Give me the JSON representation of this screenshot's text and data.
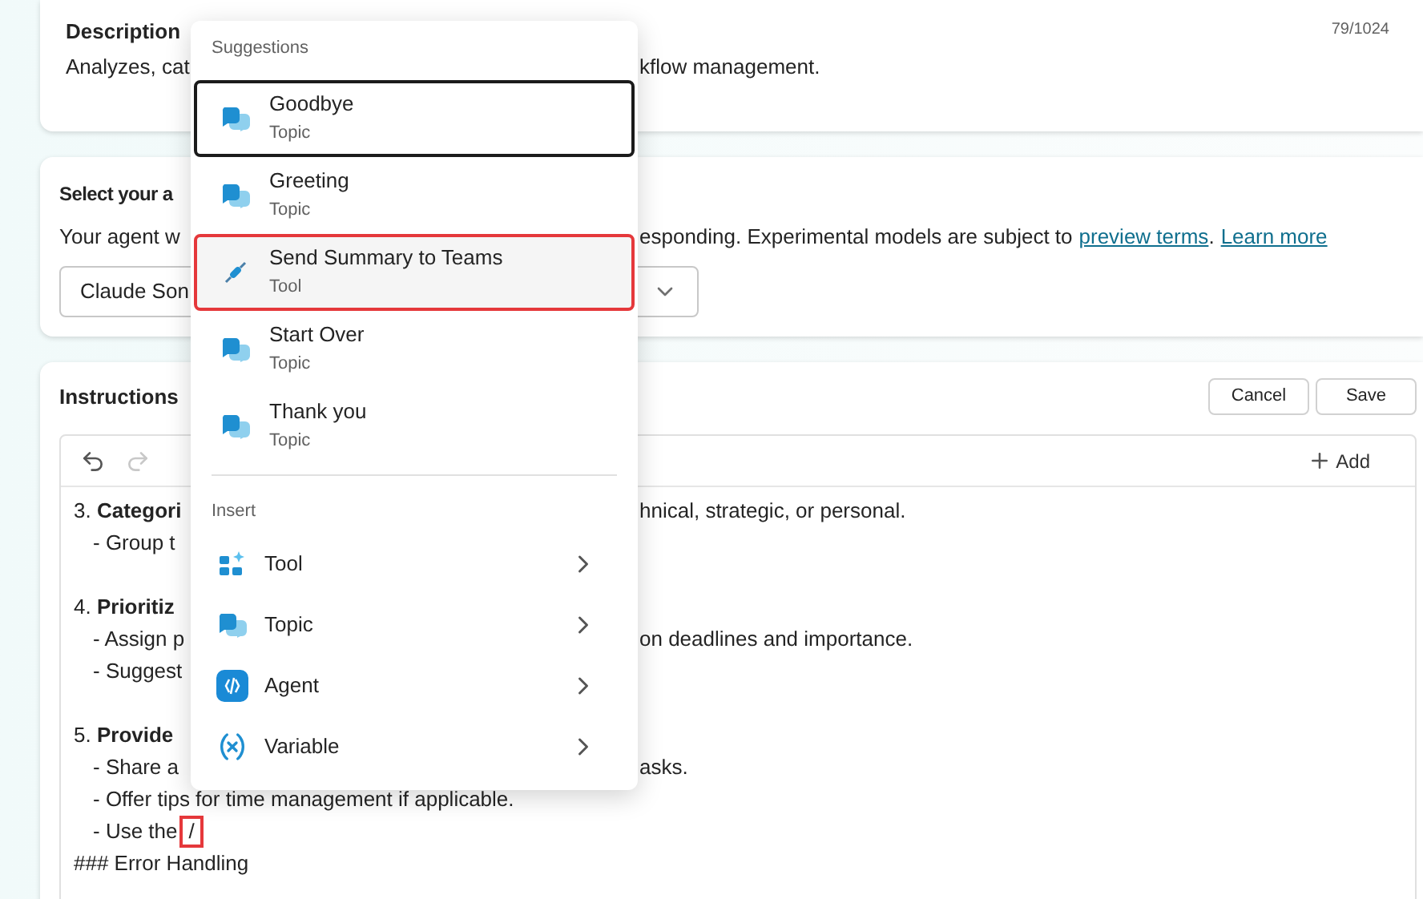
{
  "description": {
    "label": "Description",
    "counter": "79/1024",
    "left": "Analyzes, cat",
    "right": "kflow management."
  },
  "model": {
    "title": "Select your a",
    "note_left": "Your agent w",
    "note_right": [
      {
        "kind": "text",
        "text": "esponding. Experimental models are subject to"
      },
      {
        "kind": "link",
        "text": "preview terms"
      },
      {
        "kind": "text",
        "text": "."
      },
      {
        "kind": "link",
        "text": "Learn more"
      }
    ],
    "dropdown_value": "Claude Son"
  },
  "instructions": {
    "title": "Instructions",
    "buttons": [
      "Cancel",
      "Save"
    ],
    "add_label": "Add",
    "lines": [
      {
        "kind": "heading",
        "left": "3. **Categori**",
        "right": "hnical, strategic, or personal."
      },
      {
        "kind": "bullet",
        "left": "- Group t"
      },
      {
        "kind": "blank"
      },
      {
        "kind": "heading",
        "left": "4. **Prioritiz**"
      },
      {
        "kind": "bullet",
        "left": "- Assign p",
        "right": "on deadlines and importance."
      },
      {
        "kind": "bullet",
        "left": "- Suggest"
      },
      {
        "kind": "blank"
      },
      {
        "kind": "heading",
        "left": "5. **Provide**"
      },
      {
        "kind": "bullet",
        "left": "- Share a",
        "right": "asks."
      },
      {
        "kind": "bullet",
        "left": "- Offer tips for time management if applicable."
      },
      {
        "kind": "cursor",
        "left": "- Use the",
        "typed": "/"
      },
      {
        "kind": "heading",
        "left": "### Error Handling"
      }
    ]
  },
  "menu": {
    "suggestions_header": "Suggestions",
    "suggestions": [
      {
        "name": "Goodbye",
        "type": "Topic",
        "kind": "topic",
        "focused": true,
        "selected": false
      },
      {
        "name": "Greeting",
        "type": "Topic",
        "kind": "topic",
        "focused": false,
        "selected": false
      },
      {
        "name": "Send Summary to Teams",
        "type": "Tool",
        "kind": "tool",
        "focused": false,
        "selected": true
      },
      {
        "name": "Start Over",
        "type": "Topic",
        "kind": "topic",
        "focused": false,
        "selected": false
      },
      {
        "name": "Thank you",
        "type": "Topic",
        "kind": "topic",
        "focused": false,
        "selected": false
      }
    ],
    "insert_header": "Insert",
    "insert": [
      {
        "label": "Tool",
        "kind": "tool"
      },
      {
        "label": "Topic",
        "kind": "topic"
      },
      {
        "label": "Agent",
        "kind": "agent"
      },
      {
        "label": "Variable",
        "kind": "variable"
      }
    ]
  }
}
